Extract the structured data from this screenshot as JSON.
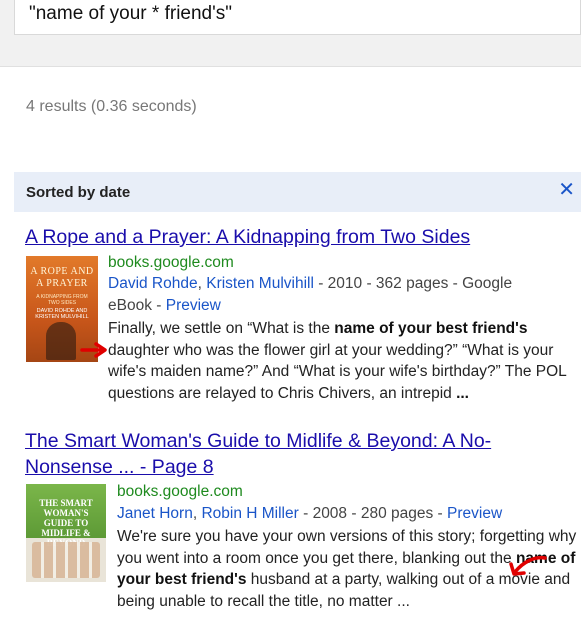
{
  "search": {
    "query": "\"name of your * friend's\""
  },
  "stats": "4 results (0.36 seconds)",
  "sort": {
    "label": "Sorted by date",
    "close": "✕"
  },
  "results": [
    {
      "title": "A Rope and a Prayer: A Kidnapping from Two Sides",
      "source": "books.google.com",
      "author1": "David Rohde",
      "author2": "Kristen Mulvihill",
      "meta_tail": " - 2010 - 362 pages - Google",
      "meta_tail2": "eBook - ",
      "preview": "Preview",
      "cover": {
        "title": "A ROPE AND A PRAYER",
        "subtitle": "A KIDNAPPING FROM TWO SIDES",
        "authors": "DAVID ROHDE AND KRISTEN MULVIHILL"
      },
      "snip": [
        "Finally, we settle on “What is the ",
        "name of your best friend's",
        " daughter who was the flower girl at your wedding?” “What is your wife's maiden name?” And “What is your wife's birthday?” The POL questions are relayed to Chris Chivers, an intrepid ",
        "..."
      ]
    },
    {
      "title": "The Smart Woman's Guide to Midlife & Beyond: A No-Nonsense ... - Page 8",
      "source": "books.google.com",
      "author1": "Janet Horn",
      "author2": "Robin H Miller",
      "meta_tail": " - 2008 - 280 pages - ",
      "preview": "Preview",
      "cover": {
        "title": "THE SMART WOMAN'S GUIDE TO MIDLIFE & BEYOND"
      },
      "snip": [
        "We're sure you have your own versions of this story; forgetting why you went into a room once you get there, blanking out the ",
        "name of your best friend's",
        " husband at a party, walking out of a movie and being unable to recall the title, no matter ..."
      ]
    }
  ],
  "colors": {
    "link": "#1a0dab",
    "url": "#1e8a1e",
    "accent_arrow": "#e00000",
    "sortbar": "#e8eef8"
  }
}
